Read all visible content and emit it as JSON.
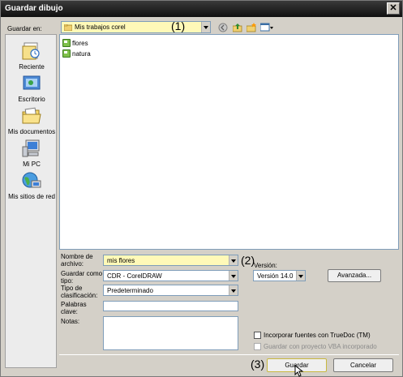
{
  "window": {
    "title": "Guardar dibujo"
  },
  "toolbar": {
    "save_in_label": "Guardar en:",
    "save_in_value": "Mis trabajos corel"
  },
  "places": [
    {
      "label": "Reciente"
    },
    {
      "label": "Escritorio"
    },
    {
      "label": "Mis documentos"
    },
    {
      "label": "Mi PC"
    },
    {
      "label": "Mis sitios de red"
    }
  ],
  "files": [
    {
      "name": "flores"
    },
    {
      "name": "natura"
    }
  ],
  "form": {
    "filename_label": "Nombre de archivo:",
    "filename_value": "mis flores",
    "savetype_label": "Guardar como tipo:",
    "savetype_value": "CDR - CorelDRAW",
    "sorttype_label": "Tipo de clasificación:",
    "sorttype_value": "Predeterminado",
    "keywords_label": "Palabras clave:",
    "keywords_value": "",
    "notes_label": "Notas:",
    "notes_value": "",
    "version_label": "Versión:",
    "version_value": "Versión 14.0",
    "advanced_label": "Avanzada...",
    "embed_fonts_label": "Incorporar fuentes con TrueDoc (TM)",
    "vba_label": "Guardar con proyecto VBA incorporado",
    "save_label": "Guardar",
    "cancel_label": "Cancelar"
  },
  "annotations": {
    "a1": "(1)",
    "a2": "(2)",
    "a3": "(3)"
  },
  "colors": {
    "highlight": "#fff9b8",
    "titlebar": "#1a1a1a",
    "dialog_bg": "#d4d0c8"
  }
}
